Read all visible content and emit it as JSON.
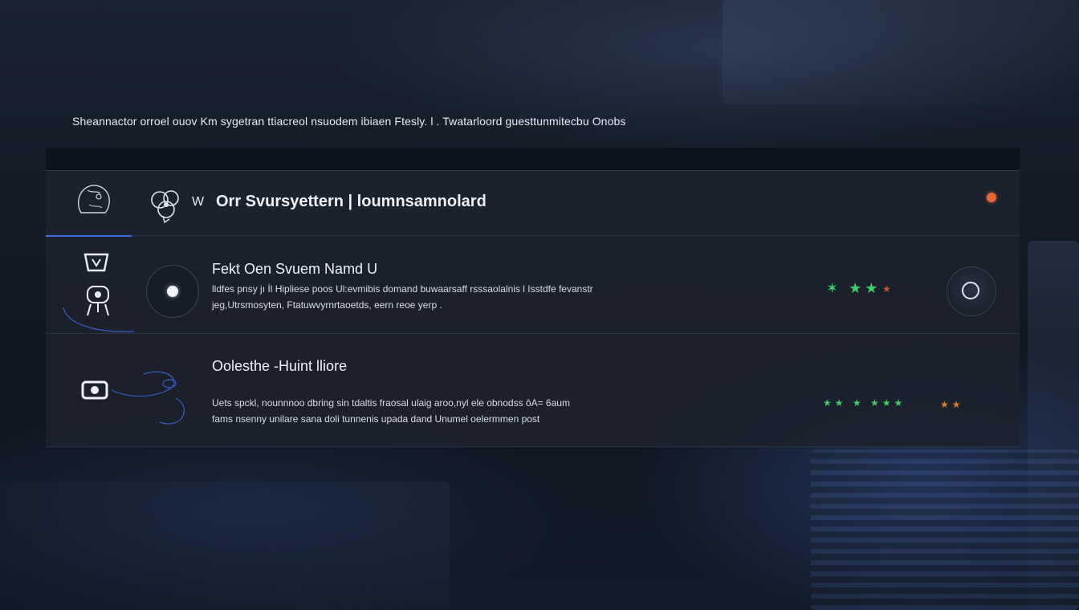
{
  "caption": "Sheannactor orroel ouov Km sygetran ttiacreol nsuodem ibiaen Ftesly. l . Twatarloord guesttunmitecbu Onobs",
  "header": {
    "badge": "W",
    "title": "Orr Svursyettern | loumnsamnolard"
  },
  "rows": [
    {
      "title": "Fekt Oen Svuem Namd U",
      "desc_line1": "lldfes pnsy jı İl Hipliese poos Ul:evmibis domand buwaarsaff rsssaolalnis l Isstdfe fevanstr",
      "desc_line2": "jeg,Utrsmosyten, Ftatuwvyrnrtaoetds, eern reoe yerp .",
      "rating": "✶ ★★",
      "rating_extra": "★"
    },
    {
      "title": "Oolesthe -Huint lliore",
      "desc_line1": "Uets spckl, nounnnoo dbring sin tdaltis fraosal ulaig aroo,nyl ele obnodss ôA= 6aum",
      "desc_line2": "fams nsenny unilare sana doli tunnenis upada dand Unumel oelermmen post",
      "rating": "★★ ★ ★★★",
      "rating_extra": "★★"
    }
  ],
  "colors": {
    "accent_blue": "#3d6de0",
    "rating_green": "#3fcf6a",
    "rating_orange": "#e07a2a",
    "alert_dot": "#e2683a"
  },
  "icons": {
    "side_tab": "head-profile-icon",
    "header_logo": "brain-logo-icon",
    "row1_left_top": "helmet-icon",
    "row1_left_bottom": "robot-icon",
    "row1_orbit": "orbit-icon",
    "row1_action": "circle-action-icon",
    "row2_left": "camera-icon"
  }
}
